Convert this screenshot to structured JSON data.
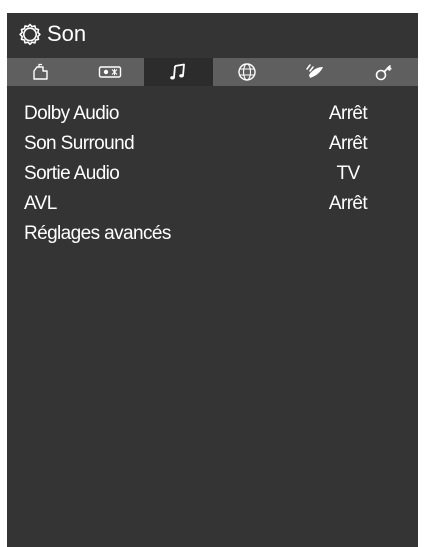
{
  "header": {
    "title": "Son",
    "icon": "gear-icon"
  },
  "tabs": [
    {
      "icon": "picture-icon",
      "active": false
    },
    {
      "icon": "av-input-icon",
      "active": false
    },
    {
      "icon": "music-note-icon",
      "active": true
    },
    {
      "icon": "network-globe-icon",
      "active": false
    },
    {
      "icon": "satellite-icon",
      "active": false
    },
    {
      "icon": "settings-key-icon",
      "active": false
    }
  ],
  "menu": {
    "items": [
      {
        "label": "Dolby Audio",
        "value": "Arrêt"
      },
      {
        "label": "Son Surround",
        "value": "Arrêt"
      },
      {
        "label": "Sortie Audio",
        "value": "TV"
      },
      {
        "label": "AVL",
        "value": "Arrêt"
      },
      {
        "label": "Réglages avancés",
        "value": ""
      }
    ]
  },
  "colors": {
    "background": "#343434",
    "tab_bar": "#5f5f5f",
    "tab_active": "#2c2c2c",
    "text": "#ffffff"
  }
}
